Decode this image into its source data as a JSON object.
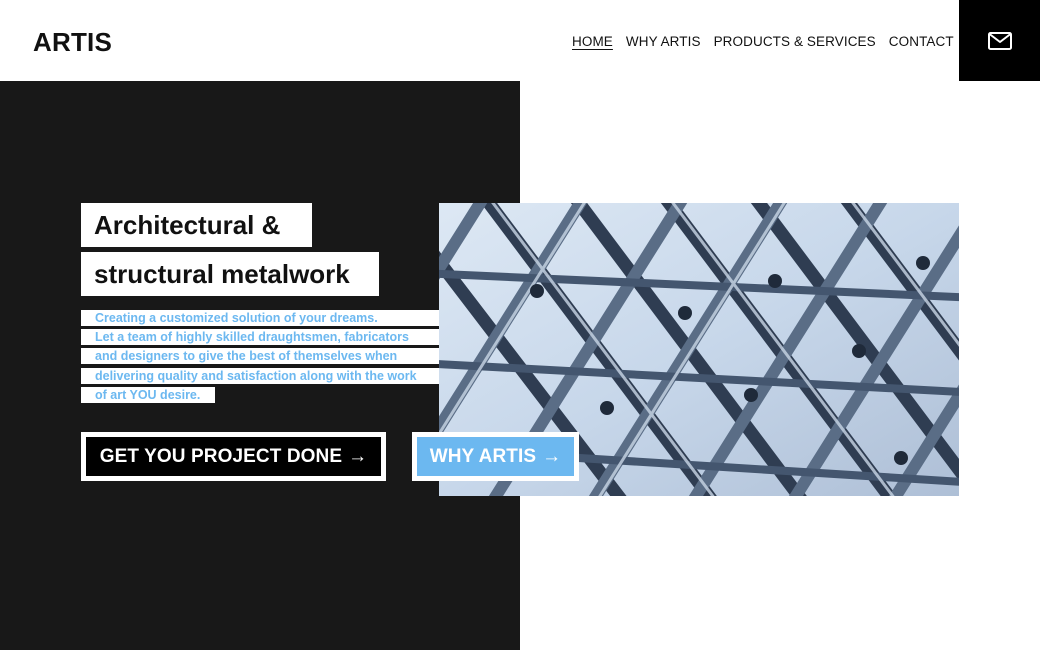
{
  "header": {
    "logo": "ARTIS",
    "nav": [
      {
        "label": "HOME",
        "active": true
      },
      {
        "label": "WHY ARTIS",
        "active": false
      },
      {
        "label": "PRODUCTS & SERVICES",
        "active": false
      },
      {
        "label": "CONTACT",
        "active": false
      }
    ],
    "mail_icon": "mail-icon"
  },
  "hero": {
    "headline": [
      "Architectural &",
      "structural metalwork"
    ],
    "description": [
      "Creating a customized solution of your dreams.",
      "Let a team of highly skilled draughtsmen, fabricators",
      "and designers to give the best of themselves when",
      "delivering quality and satisfaction along with the work",
      "of art YOU desire."
    ],
    "primary_button": "GET YOU PROJECT DONE",
    "secondary_button": "WHY ARTIS",
    "arrow_glyph": "→",
    "image": "steel-lattice-roof-photo"
  },
  "colors": {
    "accent": "#6cb8f0",
    "dark_panel": "#181818",
    "black": "#000000",
    "white": "#ffffff"
  }
}
